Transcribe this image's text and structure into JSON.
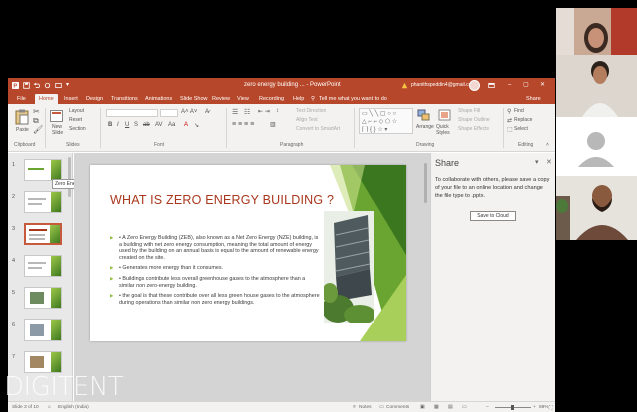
{
  "titlebar": {
    "doc_title": "zero energy building ... - PowerPoint",
    "user_email": "phanithspeddin4@gmail.com"
  },
  "ribbon_tabs": [
    "File",
    "Home",
    "Insert",
    "Design",
    "Transitions",
    "Animations",
    "Slide Show",
    "Review",
    "View",
    "Recording",
    "Help",
    "Tell me what you want to do",
    "Share"
  ],
  "ribbon": {
    "clipboard": {
      "paste": "Paste",
      "label": "Clipboard"
    },
    "slides": {
      "new_slide": "New Slide",
      "layout": "Layout",
      "reset": "Reset",
      "section": "Section",
      "label": "Slides"
    },
    "font": {
      "label": "Font"
    },
    "paragraph": {
      "text_direction": "Text Direction",
      "align_text": "Align Text",
      "convert_smartart": "Convert to SmartArt",
      "label": "Paragraph"
    },
    "drawing": {
      "arrange": "Arrange",
      "quick_styles": "Quick Styles",
      "shape_fill": "Shape Fill",
      "shape_outline": "Shape Outline",
      "shape_effects": "Shape Effects",
      "label": "Drawing"
    },
    "editing": {
      "find": "Find",
      "replace": "Replace",
      "select": "Select",
      "label": "Editing"
    }
  },
  "thumbnails": [
    "1",
    "2",
    "3",
    "4",
    "5",
    "6",
    "7"
  ],
  "tooltip": "Zero Energy Building",
  "slide": {
    "title": "WHAT IS ZERO ENERGY BUILDING ?",
    "bullets": [
      "• A Zero Energy Building (ZEB), also known as a Net Zero Energy (NZE) building, is a building with net zero energy consumption, meaning the total amount of energy used by the building on an annual basis is equal to the amount of renewable energy created on the site.",
      "• Generates more energy than it consumes.",
      "• Buildings contribute less overall greenhouse gases to the atmosphere than a similar non zero-energy building.",
      "• the goal is that these contribute over all less green house gases to the atmosphere during operations than similar non zero energy buildings."
    ]
  },
  "share": {
    "title": "Share",
    "message": "To collaborate with others, please save a copy of your file to an online location and change the file type to .pptx.",
    "button": "Save to Cloud"
  },
  "statusbar": {
    "slide_info": "Slide 3 of 10",
    "language": "English (India)",
    "notes": "Notes",
    "comments": "Comments",
    "zoom": "69%"
  },
  "watermark": "DIGITENT",
  "colors": {
    "accent": "#b7472a",
    "slide_title": "#a9371d",
    "slide_green": "#6aa531"
  }
}
